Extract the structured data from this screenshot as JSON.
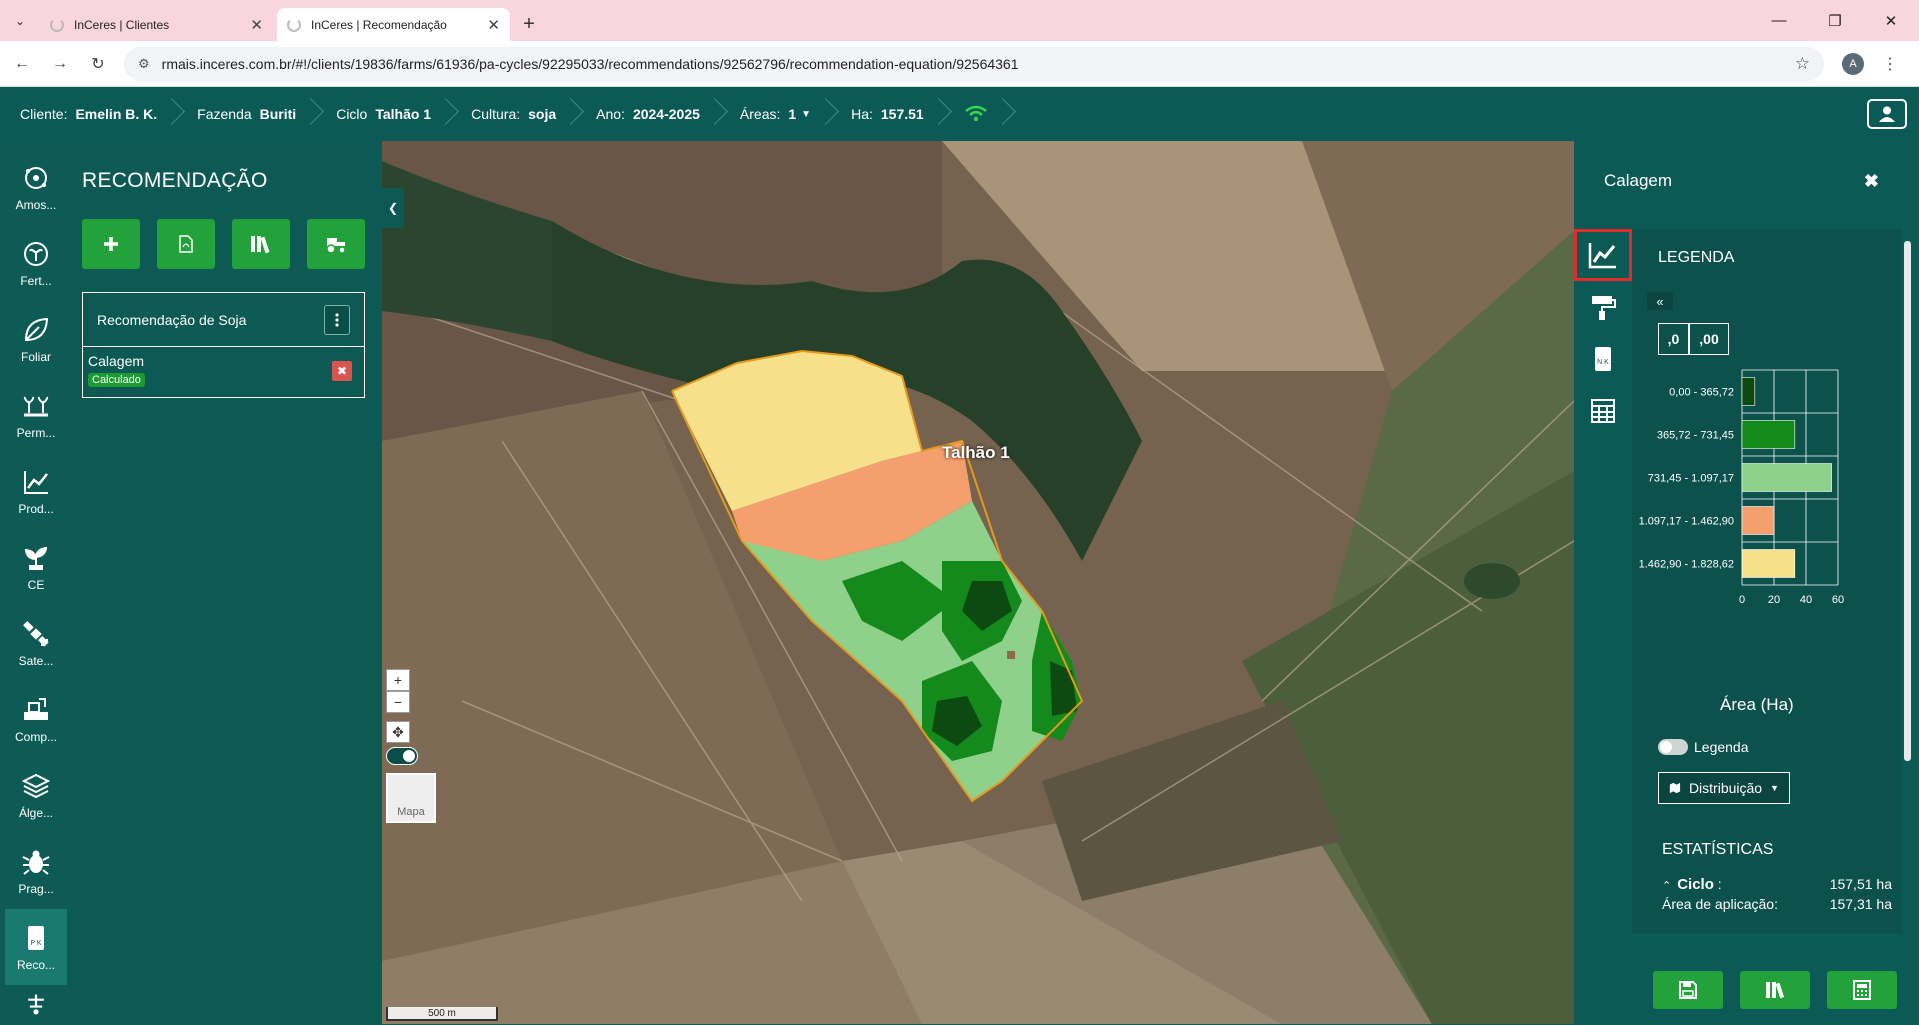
{
  "browser": {
    "tabs": [
      {
        "title": "InCeres | Clientes"
      },
      {
        "title": "InCeres | Recomendação"
      }
    ],
    "url": "rmais.inceres.com.br/#!/clients/19836/farms/61936/pa-cycles/92295033/recommendations/92562796/recommendation-equation/92564361",
    "profile_initial": "A"
  },
  "header": {
    "crumbs": [
      {
        "key": "Cliente:",
        "value": "Emelin B. K."
      },
      {
        "key": "Fazenda",
        "value": "Buriti"
      },
      {
        "key": "Ciclo",
        "value": "Talhão 1"
      },
      {
        "key": "Cultura:",
        "value": "soja"
      },
      {
        "key": "Ano:",
        "value": "2024-2025"
      },
      {
        "key": "Áreas:",
        "value": "1"
      },
      {
        "key": "Ha:",
        "value": "157.51"
      }
    ]
  },
  "rail": {
    "items": [
      {
        "label": "Amos...",
        "icon": "sampling-icon"
      },
      {
        "label": "Fert...",
        "icon": "fertility-icon"
      },
      {
        "label": "Foliar",
        "icon": "leaf-icon"
      },
      {
        "label": "Perm...",
        "icon": "plants-icon"
      },
      {
        "label": "Prod...",
        "icon": "chart-icon"
      },
      {
        "label": "CE",
        "icon": "sprout-icon"
      },
      {
        "label": "Sate...",
        "icon": "satellite-icon"
      },
      {
        "label": "Comp...",
        "icon": "tractor-icon"
      },
      {
        "label": "Álge...",
        "icon": "layers-icon"
      },
      {
        "label": "Prag...",
        "icon": "bug-icon"
      },
      {
        "label": "Reco...",
        "icon": "recommendation-icon"
      }
    ]
  },
  "recommendation": {
    "title": "RECOMENDAÇÃO",
    "card_title": "Recomendação de Soja",
    "item_name": "Calagem",
    "item_status": "Calculado"
  },
  "map": {
    "field_label": "Talhão 1",
    "basemap_label": "Mapa",
    "scale_label": "500 m",
    "zone_colors": [
      "#0d4a12",
      "#14891c",
      "#8fd08a",
      "#f4a06e",
      "#f7e08a"
    ]
  },
  "right_panel": {
    "title": "Calagem",
    "legend_title": "LEGENDA",
    "decimal_less": ",0",
    "decimal_more": ",00",
    "axis_caption": "Área (Ha)",
    "legend_toggle_label": "Legenda",
    "distribution_label": "Distribuição",
    "stats_title": "ESTATÍSTICAS",
    "stats": [
      {
        "key": "Ciclo",
        "sep": ":",
        "value": "157,51 ha"
      },
      {
        "key": "Área de aplicação:",
        "sep": "",
        "value": "157,31 ha"
      }
    ]
  },
  "chart_data": {
    "type": "bar",
    "orientation": "horizontal",
    "categories": [
      "0,00 - 365,72",
      "365,72 - 731,45",
      "731,45 - 1.097,17",
      "1.097,17 - 1.462,90",
      "1.462,90 - 1.828,62"
    ],
    "values": [
      8,
      33,
      56,
      20,
      33
    ],
    "colors": [
      "#0d4a12",
      "#14891c",
      "#8fd08a",
      "#f4a06e",
      "#f7e08a"
    ],
    "xticks": [
      "0",
      "20",
      "40",
      "60"
    ],
    "xlim": [
      0,
      60
    ],
    "xlabel": "Área (Ha)",
    "grid": true
  }
}
